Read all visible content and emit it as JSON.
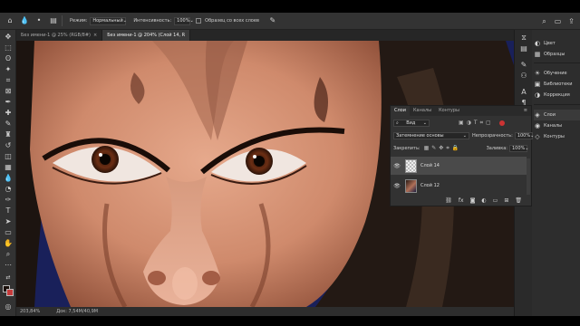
{
  "options_bar": {
    "mode_label": "Режим:",
    "mode_value": "Нормальный",
    "intensity_label": "Интенсивность:",
    "intensity_value": "100%",
    "sample_all_label": "Образец со всех слоев"
  },
  "tabs": [
    {
      "label": "Без имени-1 @ 25% (RGB/8#)"
    },
    {
      "label": "Без имени-1 @ 204% (Слой 14, R"
    }
  ],
  "status": {
    "zoom": "203,84%",
    "doc": "Док: 7,54M/40,9M"
  },
  "right_panels": [
    {
      "icon": "color-wheel-icon",
      "label": "Цвет"
    },
    {
      "icon": "swatches-grid-icon",
      "label": "Образцы"
    },
    {
      "icon": "lightbulb-icon",
      "label": "Обучение"
    },
    {
      "icon": "library-icon",
      "label": "Библиотеки"
    },
    {
      "icon": "adjustments-icon",
      "label": "Коррекция"
    },
    {
      "icon": "layers-icon",
      "label": "Слои"
    },
    {
      "icon": "channels-icon",
      "label": "Каналы"
    },
    {
      "icon": "paths-icon",
      "label": "Контуры"
    }
  ],
  "layers_panel": {
    "tabs": [
      "Слои",
      "Каналы",
      "Контуры"
    ],
    "filter_kind": "Вид",
    "blend_mode": "Затемнение основы",
    "opacity_label": "Непрозрачность:",
    "opacity_value": "100%",
    "lock_label": "Закрепить:",
    "fill_label": "Заливка:",
    "fill_value": "100%",
    "layers": [
      {
        "name": "Слой 14",
        "selected": true,
        "visible": true
      },
      {
        "name": "Слой 12",
        "selected": false,
        "visible": true
      }
    ]
  },
  "colors": {
    "foreground": "#1a0f0a",
    "background": "#c63b3b",
    "canvas_bg": "#1a2060"
  }
}
